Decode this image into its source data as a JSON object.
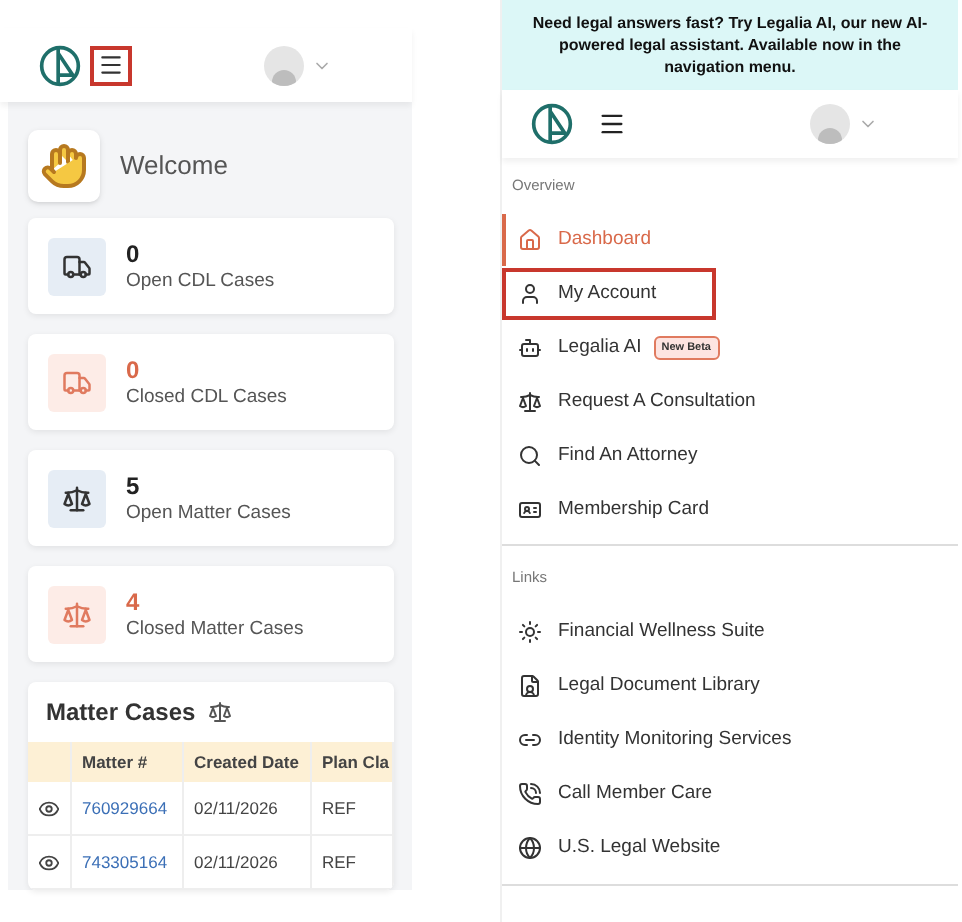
{
  "left": {
    "header": {
      "menu_highlighted": true
    },
    "welcome": "Welcome",
    "stats": [
      {
        "value": "0",
        "label": "Open CDL Cases",
        "kind": "open"
      },
      {
        "value": "0",
        "label": "Closed CDL Cases",
        "kind": "closed"
      },
      {
        "value": "5",
        "label": "Open Matter Cases",
        "kind": "open"
      },
      {
        "value": "4",
        "label": "Closed Matter Cases",
        "kind": "closed"
      }
    ],
    "matter_cases": {
      "title": "Matter Cases",
      "columns": [
        "Matter #",
        "Created Date",
        "Plan Cla"
      ],
      "rows": [
        [
          "760929664",
          "02/11/2026",
          "REF"
        ],
        [
          "743305164",
          "02/11/2026",
          "REF"
        ]
      ]
    }
  },
  "right": {
    "banner": "Need legal answers fast? Try Legalia AI, our new AI-powered legal assistant. Available now in the navigation menu.",
    "sections": [
      {
        "title": "Overview",
        "items": [
          {
            "label": "Dashboard",
            "selected": true,
            "highlighted": false
          },
          {
            "label": "My Account",
            "selected": false,
            "highlighted": true
          },
          {
            "label": "Legalia AI",
            "selected": false,
            "highlighted": false,
            "badge": "New Beta"
          },
          {
            "label": "Request A Consultation",
            "selected": false,
            "highlighted": false
          },
          {
            "label": "Find An Attorney",
            "selected": false,
            "highlighted": false
          },
          {
            "label": "Membership Card",
            "selected": false,
            "highlighted": false
          }
        ]
      },
      {
        "title": "Links",
        "items": [
          {
            "label": "Financial Wellness Suite",
            "selected": false,
            "highlighted": false
          },
          {
            "label": "Legal Document Library",
            "selected": false,
            "highlighted": false
          },
          {
            "label": "Identity Monitoring Services",
            "selected": false,
            "highlighted": false
          },
          {
            "label": "Call Member Care",
            "selected": false,
            "highlighted": false
          },
          {
            "label": "U.S. Legal Website",
            "selected": false,
            "highlighted": false
          }
        ]
      }
    ]
  }
}
